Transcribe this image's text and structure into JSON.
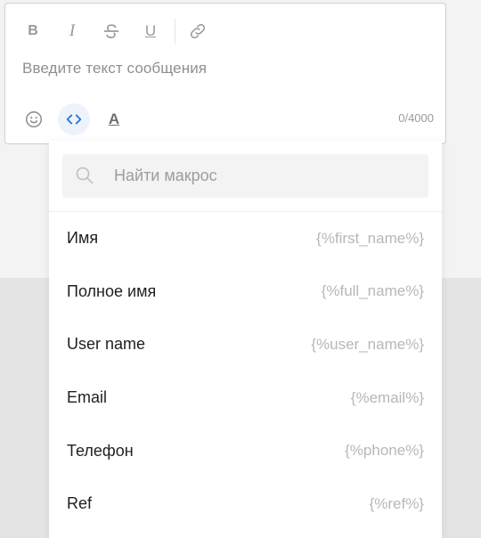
{
  "composer": {
    "toolbar": [
      {
        "name": "bold",
        "glyph": "B"
      },
      {
        "name": "italic",
        "glyph": "I"
      },
      {
        "name": "strikethrough",
        "glyph": "S"
      },
      {
        "name": "underline",
        "glyph": "U"
      }
    ],
    "placeholder": "Введите текст сообщения",
    "counter": "0/4000",
    "text_color_glyph": "A",
    "colors": {
      "accent": "#2a76d2",
      "active_bg": "#eef3fb"
    }
  },
  "macro_dropdown": {
    "search_placeholder": "Найти макрос",
    "items": [
      {
        "label": "Имя",
        "code": "{%first_name%}"
      },
      {
        "label": "Полное имя",
        "code": "{%full_name%}"
      },
      {
        "label": "User name",
        "code": "{%user_name%}"
      },
      {
        "label": "Email",
        "code": "{%email%}"
      },
      {
        "label": "Телефон",
        "code": "{%phone%}"
      },
      {
        "label": "Ref",
        "code": "{%ref%}"
      }
    ]
  }
}
